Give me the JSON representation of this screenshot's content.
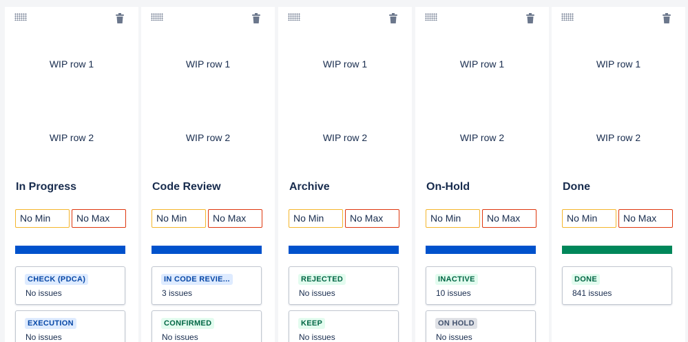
{
  "columns": [
    {
      "title": "In Progress",
      "wip_row_1": "WIP row 1",
      "wip_row_2": "WIP row 2",
      "min_label": "No Min",
      "max_label": "No Max",
      "bar_color": "#0052cc",
      "statuses": [
        {
          "name": "CHECK (PDCA)",
          "count": "No issues",
          "color": "blue"
        },
        {
          "name": "EXECUTION",
          "count": "No issues",
          "color": "blue"
        }
      ]
    },
    {
      "title": "Code Review",
      "wip_row_1": "WIP row 1",
      "wip_row_2": "WIP row 2",
      "min_label": "No Min",
      "max_label": "No Max",
      "bar_color": "#0052cc",
      "statuses": [
        {
          "name": "IN CODE REVIE...",
          "count": "3 issues",
          "color": "blue"
        },
        {
          "name": "CONFIRMED",
          "count": "No issues",
          "color": "green"
        }
      ]
    },
    {
      "title": "Archive",
      "wip_row_1": "WIP row 1",
      "wip_row_2": "WIP row 2",
      "min_label": "No Min",
      "max_label": "No Max",
      "bar_color": "#0052cc",
      "statuses": [
        {
          "name": "REJECTED",
          "count": "No issues",
          "color": "green"
        },
        {
          "name": "KEEP",
          "count": "No issues",
          "color": "green"
        }
      ]
    },
    {
      "title": "On-Hold",
      "wip_row_1": "WIP row 1",
      "wip_row_2": "WIP row 2",
      "min_label": "No Min",
      "max_label": "No Max",
      "bar_color": "#0052cc",
      "statuses": [
        {
          "name": "INACTIVE",
          "count": "10 issues",
          "color": "green"
        },
        {
          "name": "ON HOLD",
          "count": "No issues",
          "color": "grey"
        }
      ]
    },
    {
      "title": "Done",
      "wip_row_1": "WIP row 1",
      "wip_row_2": "WIP row 2",
      "min_label": "No Min",
      "max_label": "No Max",
      "bar_color": "#00875a",
      "statuses": [
        {
          "name": "DONE",
          "count": "841 issues",
          "color": "green"
        }
      ]
    }
  ],
  "icons": {
    "drag_handle": "drag-handle-icon",
    "delete": "trash-icon"
  }
}
